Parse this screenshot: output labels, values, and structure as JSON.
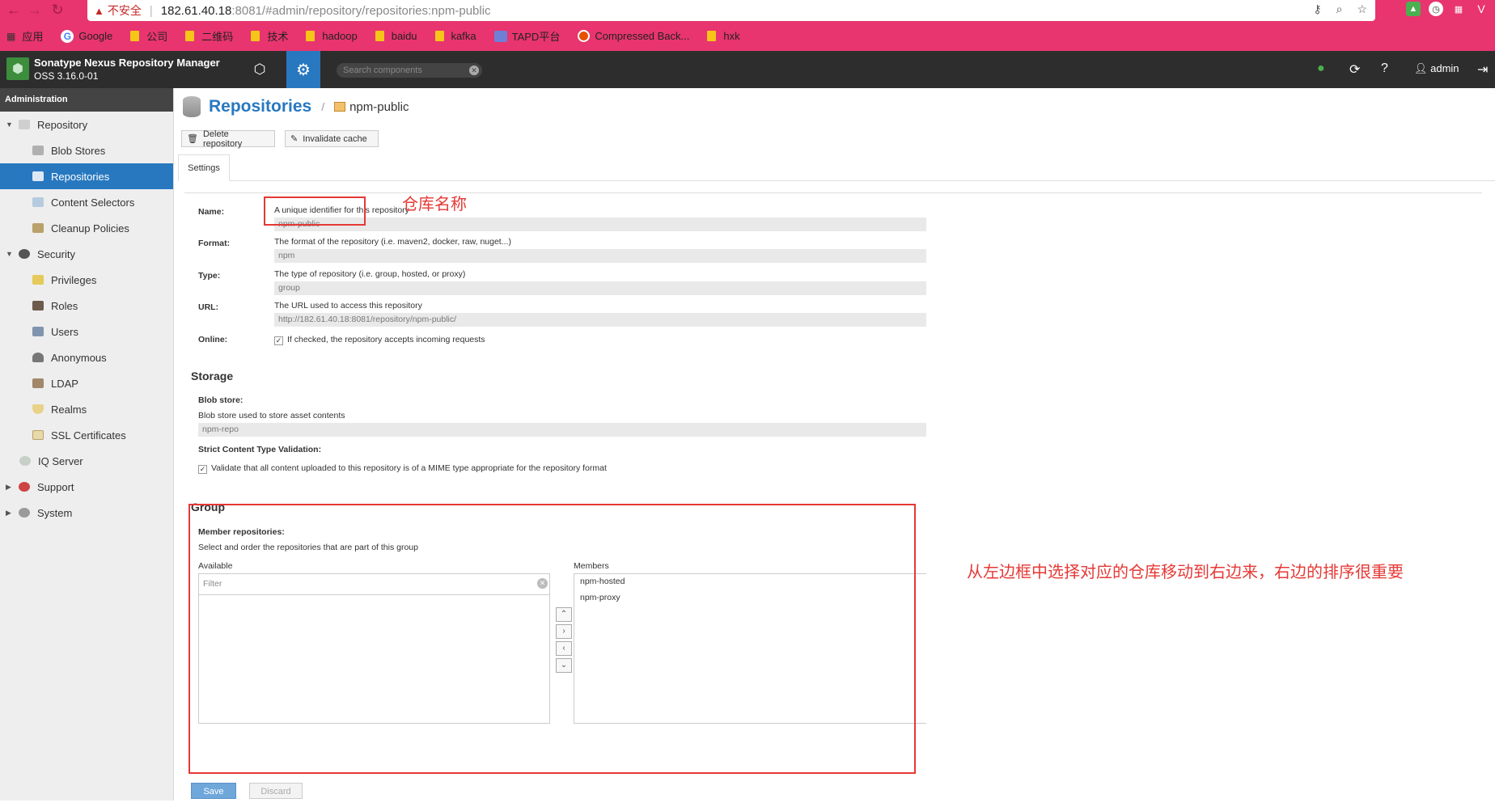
{
  "browser": {
    "insecure_label": "不安全",
    "url_host": "182.61.40.18",
    "url_rest": ":8081/#admin/repository/repositories:npm-public",
    "bookmarks": [
      "应用",
      "Google",
      "公司",
      "二维码",
      "技术",
      "hadoop",
      "baidu",
      "kafka",
      "TAPD平台",
      "Compressed Back...",
      "hxk"
    ]
  },
  "header": {
    "product_name": "Sonatype Nexus Repository Manager",
    "version": "OSS 3.16.0-01",
    "search_placeholder": "Search components",
    "user": "admin"
  },
  "sidebar": {
    "title": "Administration",
    "items": [
      {
        "label": "Repository",
        "level": 0,
        "expanded": true
      },
      {
        "label": "Blob Stores",
        "level": 1
      },
      {
        "label": "Repositories",
        "level": 1,
        "active": true
      },
      {
        "label": "Content Selectors",
        "level": 1
      },
      {
        "label": "Cleanup Policies",
        "level": 1
      },
      {
        "label": "Security",
        "level": 0,
        "expanded": true
      },
      {
        "label": "Privileges",
        "level": 1
      },
      {
        "label": "Roles",
        "level": 1
      },
      {
        "label": "Users",
        "level": 1
      },
      {
        "label": "Anonymous",
        "level": 1
      },
      {
        "label": "LDAP",
        "level": 1
      },
      {
        "label": "Realms",
        "level": 1
      },
      {
        "label": "SSL Certificates",
        "level": 1
      },
      {
        "label": "IQ Server",
        "level": 0
      },
      {
        "label": "Support",
        "level": 0,
        "expanded": false
      },
      {
        "label": "System",
        "level": 0,
        "expanded": false
      }
    ]
  },
  "main": {
    "title": "Repositories",
    "crumb": "npm-public",
    "delete_label": "Delete repository",
    "invalidate_label": "Invalidate cache",
    "tab": "Settings",
    "name_label": "Name:",
    "name_help": "A unique identifier for this repository",
    "name_value": "npm-public",
    "format_label": "Format:",
    "format_help": "The format of the repository (i.e. maven2, docker, raw, nuget...)",
    "format_value": "npm",
    "type_label": "Type:",
    "type_help": "The type of repository (i.e. group, hosted, or proxy)",
    "type_value": "group",
    "url_label": "URL:",
    "url_help": "The URL used to access this repository",
    "url_value": "http://182.61.40.18:8081/repository/npm-public/",
    "online_label": "Online:",
    "online_help": "If checked, the repository accepts incoming requests",
    "storage_title": "Storage",
    "blob_label": "Blob store:",
    "blob_help": "Blob store used to store asset contents",
    "blob_value": "npm-repo",
    "strict_label": "Strict Content Type Validation:",
    "strict_help": "Validate that all content uploaded to this repository is of a MIME type appropriate for the repository format",
    "group_title": "Group",
    "member_label": "Member repositories:",
    "member_help": "Select and order the repositories that are part of this group",
    "available_label": "Available",
    "filter_placeholder": "Filter",
    "members_label": "Members",
    "members": [
      "npm-hosted",
      "npm-proxy"
    ],
    "save_label": "Save",
    "discard_label": "Discard"
  },
  "annotations": {
    "name_note": "仓库名称",
    "group_note": "从左边框中选择对应的仓库移动到右边来，右边的排序很重要"
  },
  "colors": {
    "accent": "#2878c0",
    "annotation": "#e53935",
    "browser_bar": "#e8346f"
  }
}
